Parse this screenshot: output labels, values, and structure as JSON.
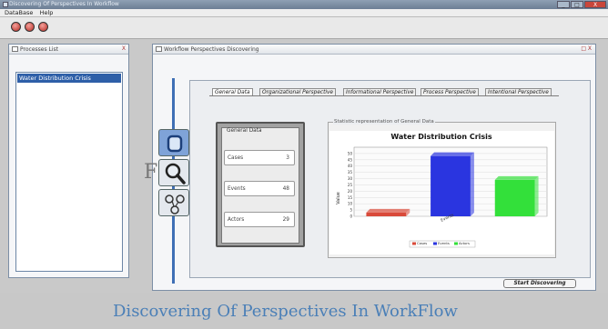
{
  "window": {
    "title": "Discovering Of Perspectives In Workflow",
    "controls": {
      "minimize": "_",
      "maximize": "□",
      "close": "X"
    }
  },
  "menu": {
    "items": [
      "DataBase",
      "Help"
    ]
  },
  "toolbar": {
    "buttons": [
      "red-circle-icon",
      "red-circle-icon",
      "red-circle-icon"
    ]
  },
  "processes_panel": {
    "title": "Processes List",
    "close_label": "X",
    "items": [
      "Water Distribution Crisis"
    ]
  },
  "discovering_panel": {
    "title": "Workflow Perspectives Discovering",
    "controls": "□ X"
  },
  "tabs": [
    {
      "label": "General Data",
      "active": true
    },
    {
      "label": "Organizational Perspective",
      "active": false
    },
    {
      "label": "Informational Perspective",
      "active": false
    },
    {
      "label": "Process Perspective",
      "active": false
    },
    {
      "label": "Intentional Perspective",
      "active": false
    }
  ],
  "side_icons": [
    "data-icon",
    "search-icon",
    "network-icon"
  ],
  "fragment_text": "F",
  "general_data": {
    "title": "General Data",
    "fields": [
      {
        "label": "Cases",
        "value": "3"
      },
      {
        "label": "Events",
        "value": "48"
      },
      {
        "label": "Actors",
        "value": "29"
      }
    ]
  },
  "chart_caption": "Statistic representation of General Data",
  "chart_data": {
    "type": "bar",
    "title": "Water Distribution Crisis",
    "ylabel": "Value",
    "xlabel": "",
    "categories": [
      "Events"
    ],
    "series": [
      {
        "name": "Cases",
        "values": [
          3
        ],
        "color": "#d94a3a"
      },
      {
        "name": "Events",
        "values": [
          48
        ],
        "color": "#2a35e0"
      },
      {
        "name": "Actors",
        "values": [
          29
        ],
        "color": "#33e03a"
      }
    ],
    "ylim": [
      0,
      55
    ],
    "yticks": [
      0,
      5,
      10,
      15,
      20,
      25,
      30,
      35,
      40,
      45,
      50
    ],
    "grid": true,
    "legend_position": "bottom"
  },
  "start_button": "Start Discovering",
  "banner_text": "Discovering Of Perspectives In WorkFlow"
}
